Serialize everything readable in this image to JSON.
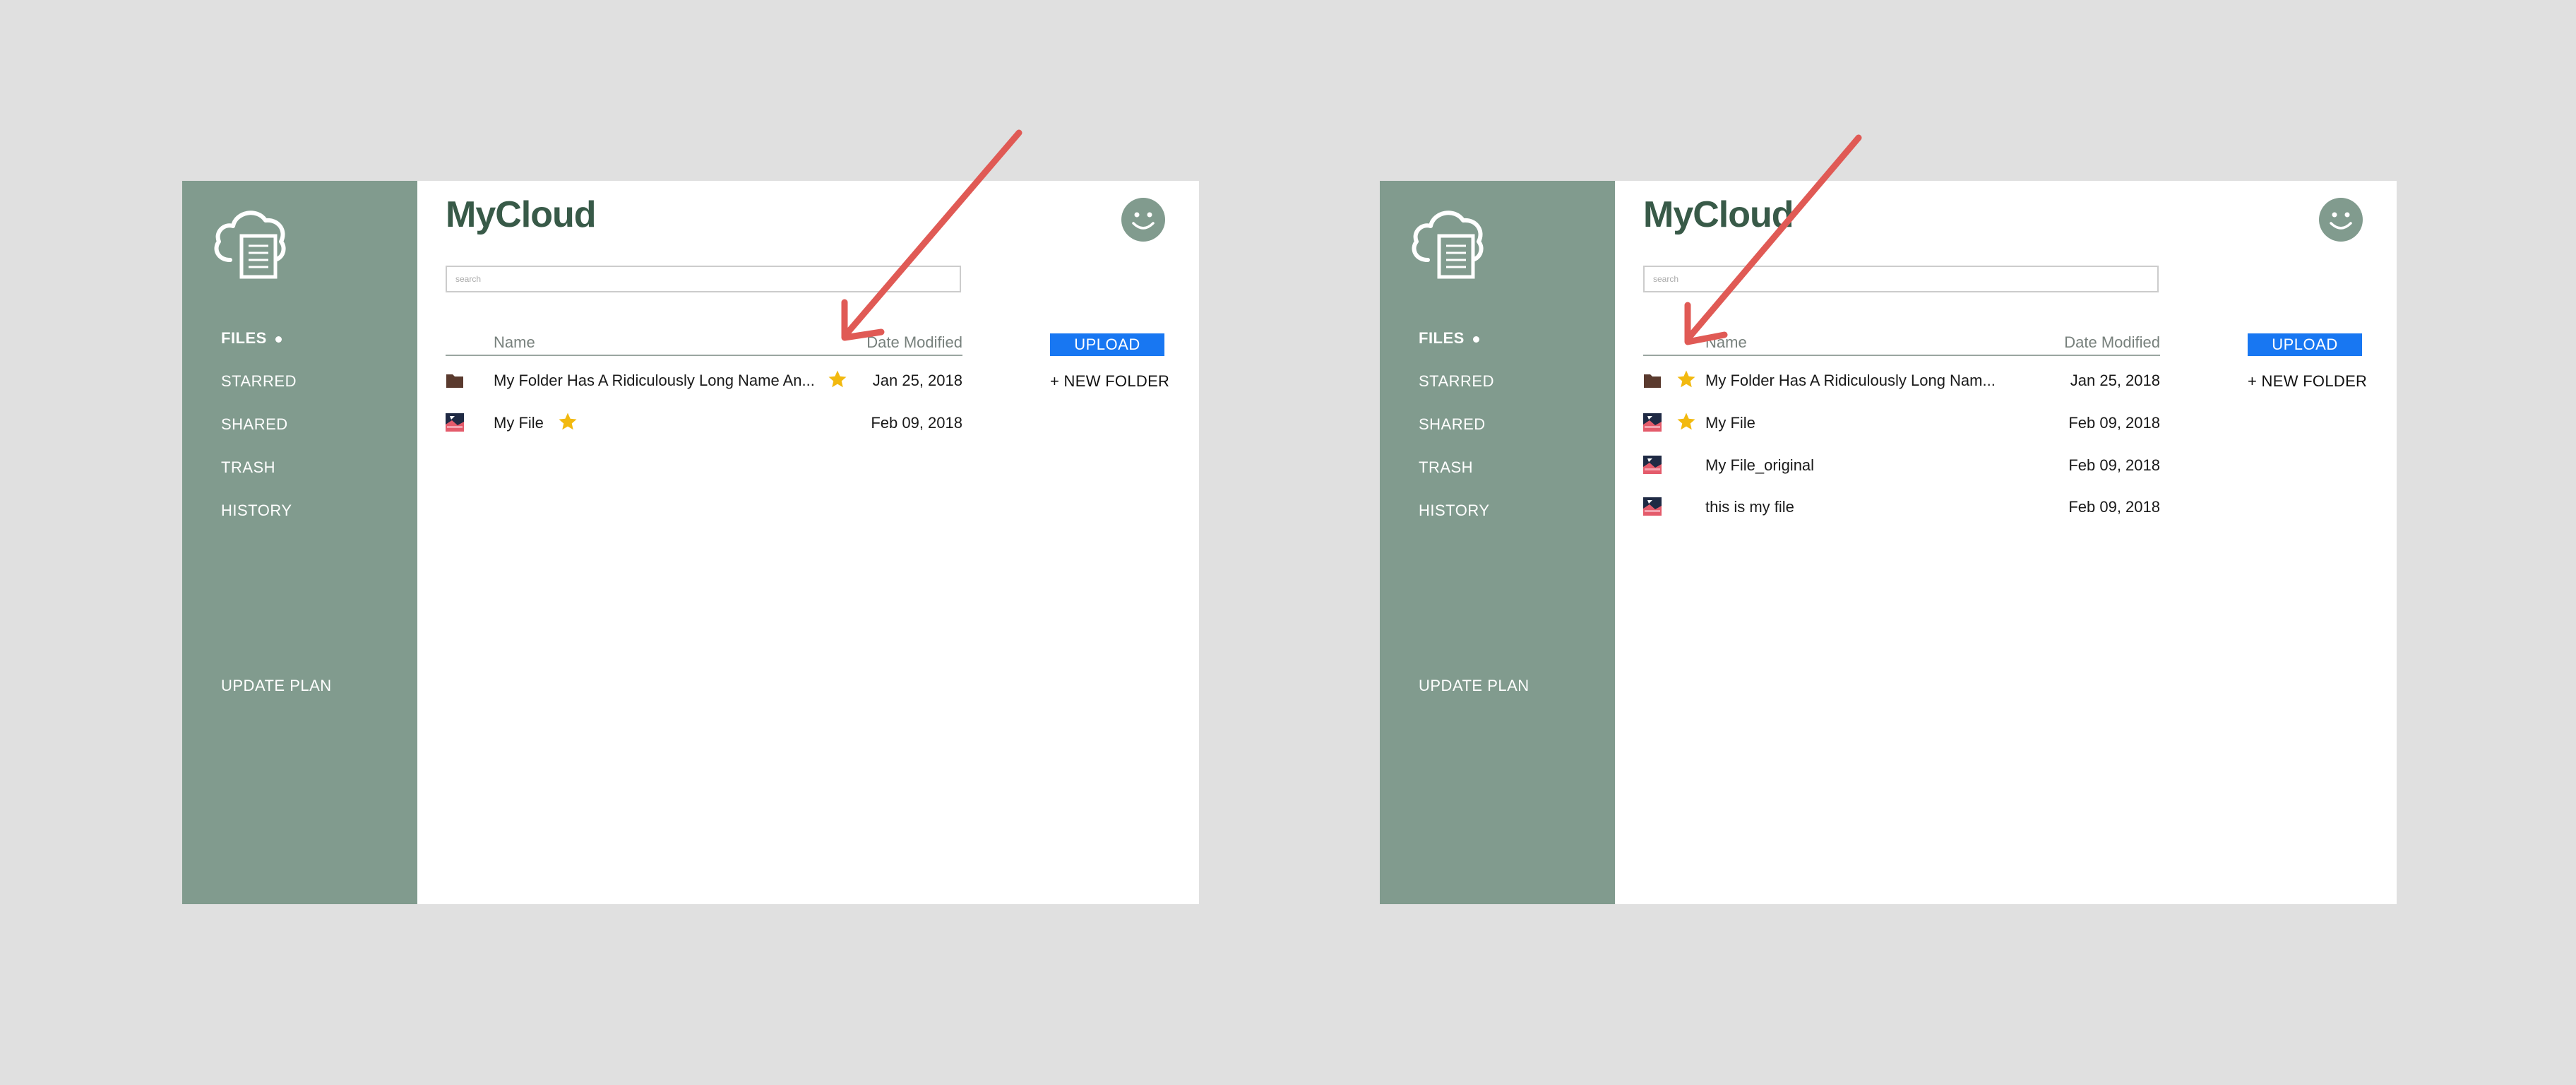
{
  "app": {
    "brand": "MyCloud",
    "nav": [
      {
        "label": "FILES",
        "active": true
      },
      {
        "label": "STARRED",
        "active": false
      },
      {
        "label": "SHARED",
        "active": false
      },
      {
        "label": "TRASH",
        "active": false
      },
      {
        "label": "HISTORY",
        "active": false
      }
    ],
    "update_plan": "UPDATE PLAN",
    "search_placeholder": "search",
    "columns": {
      "name": "Name",
      "date": "Date Modified"
    },
    "upload_label": "UPLOAD",
    "new_folder_label": "+ NEW FOLDER"
  },
  "left_panel": {
    "files": [
      {
        "name": "My Folder Has A Ridiculously Long Name An...",
        "date": "Jan 25, 2018",
        "type": "folder",
        "starred": true
      },
      {
        "name": "My File",
        "date": "Feb 09, 2018",
        "type": "file",
        "starred": true
      }
    ]
  },
  "right_panel": {
    "files": [
      {
        "name": "My Folder Has A Ridiculously Long Nam...",
        "date": "Jan 25, 2018",
        "type": "folder",
        "starred": true
      },
      {
        "name": "My File",
        "date": "Feb 09, 2018",
        "type": "file",
        "starred": true
      },
      {
        "name": "My File_original",
        "date": "Feb 09, 2018",
        "type": "file",
        "starred": false
      },
      {
        "name": "this is my file",
        "date": "Feb 09, 2018",
        "type": "file",
        "starred": false
      }
    ]
  },
  "icons": {
    "logo": "cloud-document-icon",
    "avatar": "smiley-icon",
    "folder": "folder-icon",
    "file": "image-file-icon",
    "star": "star-icon",
    "annotation": "arrow-annotation"
  },
  "colors": {
    "sidebar": "#819b8e",
    "brand": "#385a48",
    "upload": "#1877f2",
    "star": "#f2b90f",
    "folder": "#5a3a2e",
    "arrow": "#e05a55",
    "background": "#e0e0e0"
  }
}
